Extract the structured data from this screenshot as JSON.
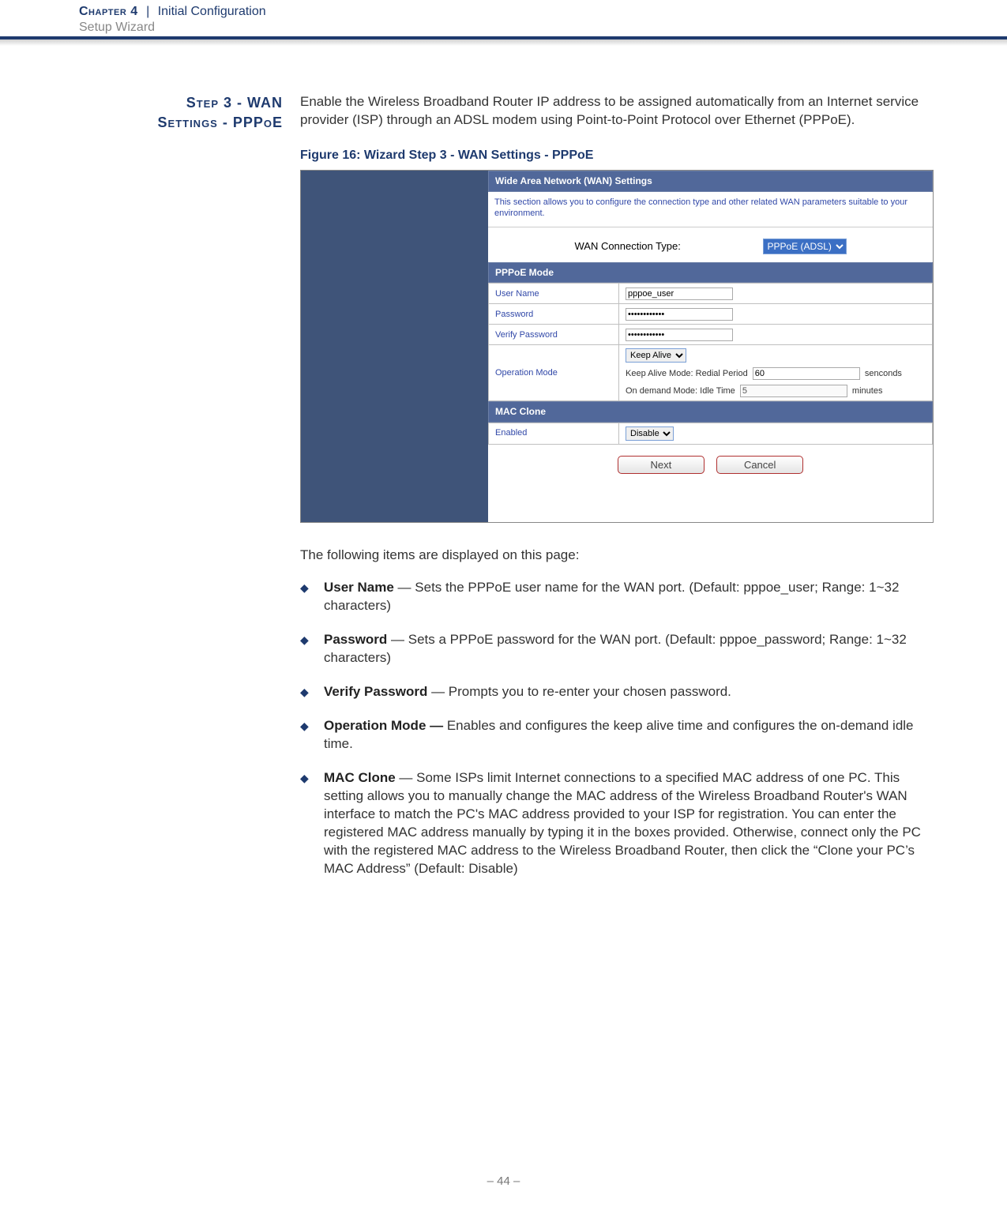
{
  "header": {
    "chapter_label": "Chapter 4",
    "pipe": "|",
    "section_title": "Initial Configuration",
    "subsection_title": "Setup Wizard"
  },
  "side_heading": {
    "line1": "Step 3 - WAN",
    "line2": "Settings - PPPoE"
  },
  "intro_paragraph": "Enable the Wireless Broadband Router IP address to be assigned automatically from an Internet service provider (ISP) through an ADSL modem using Point-to-Point Protocol over Ethernet (PPPoE).",
  "figure_caption": "Figure 16:  Wizard Step 3 - WAN Settings - PPPoE",
  "figure": {
    "section_title": "Wide Area Network (WAN) Settings",
    "section_desc": "This section allows you to configure the connection type and other related WAN parameters suitable to your environment.",
    "wan_type_label": "WAN Connection Type:",
    "wan_type_value": "PPPoE (ADSL)",
    "pppoe_header": "PPPoE Mode",
    "user_name_label": "User Name",
    "user_name_value": "pppoe_user",
    "password_label": "Password",
    "password_value": "••••••••••••",
    "verify_label": "Verify Password",
    "verify_value": "••••••••••••",
    "op_mode_label": "Operation Mode",
    "op_mode_value": "Keep Alive",
    "keep_alive_prefix": "Keep Alive Mode: Redial Period",
    "keep_alive_value": "60",
    "keep_alive_suffix": "senconds",
    "on_demand_prefix": "On demand Mode: Idle Time",
    "on_demand_value": "5",
    "on_demand_suffix": "minutes",
    "mac_clone_header": "MAC Clone",
    "enabled_label": "Enabled",
    "enabled_value": "Disable",
    "next_btn": "Next",
    "cancel_btn": "Cancel"
  },
  "after_figure_text": "The following items are displayed on this page:",
  "items": [
    {
      "term": "User Name",
      "desc": " — Sets the PPPoE user name for the WAN port. (Default: pppoe_user; Range: 1~32 characters)"
    },
    {
      "term": "Password",
      "desc": " — Sets a PPPoE password for the WAN port. (Default: pppoe_password; Range: 1~32 characters)"
    },
    {
      "term": "Verify Password",
      "desc": " — Prompts you to re-enter your chosen password."
    },
    {
      "term": "Operation Mode —",
      "desc": " Enables and configures the keep alive time and configures the on-demand idle time."
    },
    {
      "term": "MAC Clone",
      "desc": " — Some ISPs limit Internet connections to a specified MAC address of one PC. This setting allows you to manually change the MAC address of the Wireless Broadband Router's WAN interface to match the PC's MAC address provided to your ISP for registration. You can enter the registered MAC address manually by typing it in the boxes provided. Otherwise, connect only the PC with the registered MAC address to the Wireless Broadband Router, then click the “Clone your PC’s MAC Address” (Default: Disable)"
    }
  ],
  "page_number": "–  44  –"
}
